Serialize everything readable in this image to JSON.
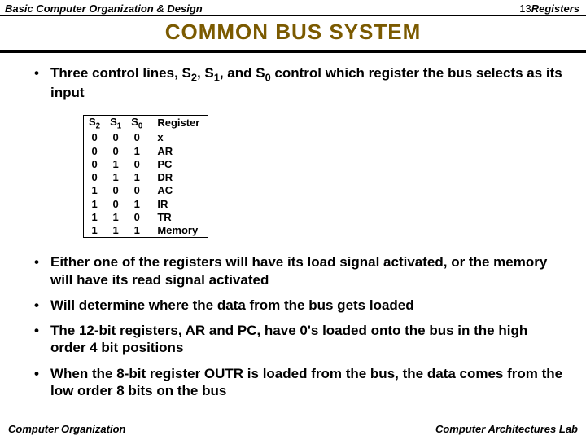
{
  "header": {
    "left": "Basic Computer Organization & Design",
    "page": "13",
    "right": "Registers"
  },
  "title": "COMMON  BUS  SYSTEM",
  "bullet1": {
    "pre": "Three control lines, S",
    "mid1": ", S",
    "mid2": ", and S",
    "post": " control which register the bus selects as its input"
  },
  "table": {
    "headers": {
      "c0": "S",
      "c1": "S",
      "c2": "S",
      "c3": "Register",
      "s0": "2",
      "s1": "1",
      "s2": "0"
    },
    "rows": [
      {
        "c0": "0",
        "c1": "0",
        "c2": "0",
        "c3": "x"
      },
      {
        "c0": "0",
        "c1": "0",
        "c2": "1",
        "c3": "AR"
      },
      {
        "c0": "0",
        "c1": "1",
        "c2": "0",
        "c3": "PC"
      },
      {
        "c0": "0",
        "c1": "1",
        "c2": "1",
        "c3": "DR"
      },
      {
        "c0": "1",
        "c1": "0",
        "c2": "0",
        "c3": "AC"
      },
      {
        "c0": "1",
        "c1": "0",
        "c2": "1",
        "c3": "IR"
      },
      {
        "c0": "1",
        "c1": "1",
        "c2": "0",
        "c3": "TR"
      },
      {
        "c0": "1",
        "c1": "1",
        "c2": "1",
        "c3": "Memory"
      }
    ]
  },
  "bullet2": "Either one of the registers will have its load signal activated, or the memory will have its read signal activated",
  "bullet2sub": "Will determine where the data from the bus gets loaded",
  "bullet3": "The 12-bit registers, AR and PC, have 0's loaded onto the bus in the high order 4 bit positions",
  "bullet4": "When the 8-bit register OUTR is loaded from the bus, the data comes from the low order 8 bits on the bus",
  "footer": {
    "left": "Computer Organization",
    "right": "Computer Architectures Lab"
  },
  "subs": {
    "s2": "2",
    "s1": "1",
    "s0": "0"
  }
}
